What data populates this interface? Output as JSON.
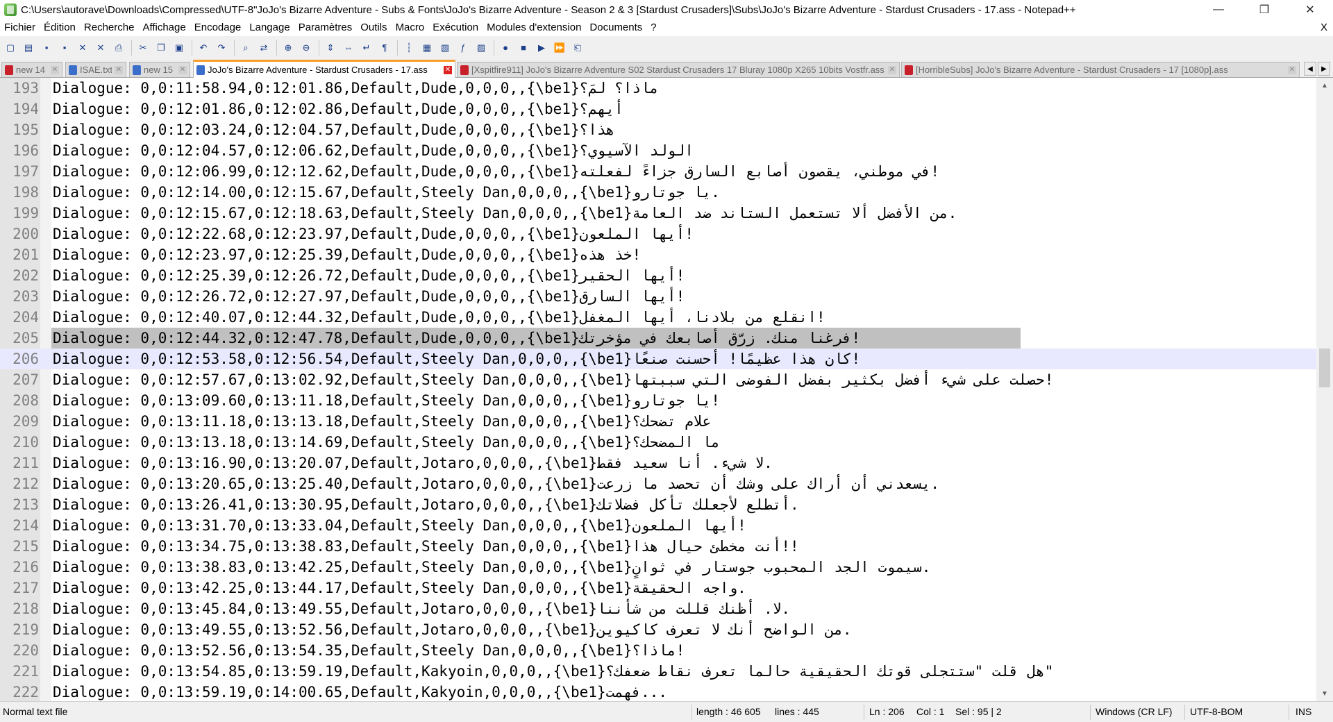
{
  "window": {
    "title": "C:\\Users\\autorave\\Downloads\\Compressed\\UTF-8\"JoJo's Bizarre Adventure - Subs & Fonts\\JoJo's Bizarre Adventure - Season 2 & 3 [Stardust Crusaders]\\Subs\\JoJo's Bizarre Adventure - Stardust Crusaders - 17.ass - Notepad++",
    "minimize": "—",
    "maximize": "❐",
    "close": "✕"
  },
  "menu": {
    "items": [
      "Fichier",
      "Édition",
      "Recherche",
      "Affichage",
      "Encodage",
      "Langage",
      "Paramètres",
      "Outils",
      "Macro",
      "Exécution",
      "Modules d'extension",
      "Documents",
      "?"
    ],
    "close": "X"
  },
  "toolbar": {
    "buttons": [
      "new-file-icon",
      "open-file-icon",
      "save-icon",
      "save-all-icon",
      "close-icon",
      "close-all-icon",
      "print-icon",
      "cut-icon",
      "copy-icon",
      "paste-icon",
      "undo-icon",
      "redo-icon",
      "find-icon",
      "replace-icon",
      "zoom-in-icon",
      "zoom-out-icon",
      "sync-vertical-icon",
      "sync-horizontal-icon",
      "word-wrap-icon",
      "show-all-chars-icon",
      "indent-guide-icon",
      "language-icon",
      "doc-map-icon",
      "function-list-icon",
      "folder-workspace-icon",
      "record-macro-icon",
      "stop-macro-icon",
      "play-macro-icon",
      "run-macro-multiple-icon",
      "save-macro-icon"
    ],
    "glyphs": [
      "▢",
      "▤",
      "▪",
      "▪",
      "✕",
      "✕",
      "⎙",
      "✂",
      "❐",
      "▣",
      "↶",
      "↷",
      "⌕",
      "⇄",
      "⊕",
      "⊖",
      "⇕",
      "⇔",
      "↵",
      "¶",
      "┆",
      "▦",
      "▧",
      "ƒ",
      "▨",
      "●",
      "■",
      "▶",
      "⏩",
      "⎗"
    ]
  },
  "tabs": [
    {
      "label": "new 14",
      "icon": "red",
      "active": false
    },
    {
      "label": "ISAE.txt",
      "icon": "blue",
      "active": false
    },
    {
      "label": "new 15",
      "icon": "blue",
      "active": false
    },
    {
      "label": "JoJo's Bizarre Adventure - Stardust Crusaders - 17.ass",
      "icon": "blue",
      "active": true
    },
    {
      "label": "[Xspitfire911] JoJo's Bizarre Adventure S02 Stardust Crusaders 17 Bluray 1080p X265 10bits Vostfr.ass",
      "icon": "red",
      "active": false
    },
    {
      "label": "[HorribleSubs] JoJo's Bizarre Adventure - Stardust Crusaders - 17 [1080p].ass",
      "icon": "red",
      "active": false
    }
  ],
  "tab_scroll": {
    "left": "◀",
    "right": "▶"
  },
  "editor": {
    "highlighted_line": "206",
    "selected_line": "205",
    "lines": [
      {
        "n": "193",
        "text": "Dialogue: 0,0:11:58.94,0:12:01.86,Default,Dude,0,0,0,,{\\be1}ماذا؟ لمَ؟"
      },
      {
        "n": "194",
        "text": "Dialogue: 0,0:12:01.86,0:12:02.86,Default,Dude,0,0,0,,{\\be1}أيهم؟"
      },
      {
        "n": "195",
        "text": "Dialogue: 0,0:12:03.24,0:12:04.57,Default,Dude,0,0,0,,{\\be1}هذا؟"
      },
      {
        "n": "196",
        "text": "Dialogue: 0,0:12:04.57,0:12:06.62,Default,Dude,0,0,0,,{\\be1}الولد الآسيوي؟"
      },
      {
        "n": "197",
        "text": "Dialogue: 0,0:12:06.99,0:12:12.62,Default,Dude,0,0,0,,{\\be1}في موطني، يقصون أصابع السارق جزاءً لفعلته!"
      },
      {
        "n": "198",
        "text": "Dialogue: 0,0:12:14.00,0:12:15.67,Default,Steely Dan,0,0,0,,{\\be1}يا جوتارو."
      },
      {
        "n": "199",
        "text": "Dialogue: 0,0:12:15.67,0:12:18.63,Default,Steely Dan,0,0,0,,{\\be1}من الأفضل ألا تستعمل الستاند ضد العامة."
      },
      {
        "n": "200",
        "text": "Dialogue: 0,0:12:22.68,0:12:23.97,Default,Dude,0,0,0,,{\\be1}أيها الملعون!"
      },
      {
        "n": "201",
        "text": "Dialogue: 0,0:12:23.97,0:12:25.39,Default,Dude,0,0,0,,{\\be1}خذ هذه!"
      },
      {
        "n": "202",
        "text": "Dialogue: 0,0:12:25.39,0:12:26.72,Default,Dude,0,0,0,,{\\be1}أيها الحقير!"
      },
      {
        "n": "203",
        "text": "Dialogue: 0,0:12:26.72,0:12:27.97,Default,Dude,0,0,0,,{\\be1}أيها السارق!"
      },
      {
        "n": "204",
        "text": "Dialogue: 0,0:12:40.07,0:12:44.32,Default,Dude,0,0,0,,{\\be1}انقلع من بلادنا، أيها المغفل!"
      },
      {
        "n": "205",
        "text": "Dialogue: 0,0:12:44.32,0:12:47.78,Default,Dude,0,0,0,,{\\be1}فرغنا منك. زرّق أصابعك في مؤخرتك!"
      },
      {
        "n": "206",
        "text": "Dialogue: 0,0:12:53.58,0:12:56.54,Default,Steely Dan,0,0,0,,{\\be1}كان هذا عظيمًا! أحسنت صنعًا!"
      },
      {
        "n": "207",
        "text": "Dialogue: 0,0:12:57.67,0:13:02.92,Default,Steely Dan,0,0,0,,{\\be1}حصلت على شيء أفضل بكثير بفضل الفوضى التي سببتها!"
      },
      {
        "n": "208",
        "text": "Dialogue: 0,0:13:09.60,0:13:11.18,Default,Steely Dan,0,0,0,,{\\be1}يا جوتارو!"
      },
      {
        "n": "209",
        "text": "Dialogue: 0,0:13:11.18,0:13:13.18,Default,Steely Dan,0,0,0,,{\\be1}علام تضحك؟"
      },
      {
        "n": "210",
        "text": "Dialogue: 0,0:13:13.18,0:13:14.69,Default,Steely Dan,0,0,0,,{\\be1}ما المضحك؟"
      },
      {
        "n": "211",
        "text": "Dialogue: 0,0:13:16.90,0:13:20.07,Default,Jotaro,0,0,0,,{\\be1}لا شيء. أنا سعيد فقط."
      },
      {
        "n": "212",
        "text": "Dialogue: 0,0:13:20.65,0:13:25.40,Default,Jotaro,0,0,0,,{\\be1}يسعدني أن أراك على وشك أن تحصد ما زرعت."
      },
      {
        "n": "213",
        "text": "Dialogue: 0,0:13:26.41,0:13:30.95,Default,Jotaro,0,0,0,,{\\be1}أتطلع لأجعلك تأكل فضلاتك."
      },
      {
        "n": "214",
        "text": "Dialogue: 0,0:13:31.70,0:13:33.04,Default,Steely Dan,0,0,0,,{\\be1}أيها الملعون!"
      },
      {
        "n": "215",
        "text": "Dialogue: 0,0:13:34.75,0:13:38.83,Default,Steely Dan,0,0,0,,{\\be1}أنت مخطئ حيال هذا!!"
      },
      {
        "n": "216",
        "text": "Dialogue: 0,0:13:38.83,0:13:42.25,Default,Steely Dan,0,0,0,,{\\be1}سيموت الجد المحبوب جوستار في ثوانٍ."
      },
      {
        "n": "217",
        "text": "Dialogue: 0,0:13:42.25,0:13:44.17,Default,Steely Dan,0,0,0,,{\\be1}واجه الحقيقة."
      },
      {
        "n": "218",
        "text": "Dialogue: 0,0:13:45.84,0:13:49.55,Default,Jotaro,0,0,0,,{\\be1}لا. أظنك قللت من شأننا."
      },
      {
        "n": "219",
        "text": "Dialogue: 0,0:13:49.55,0:13:52.56,Default,Jotaro,0,0,0,,{\\be1}من الواضح أنك لا تعرف كاكيوين."
      },
      {
        "n": "220",
        "text": "Dialogue: 0,0:13:52.56,0:13:54.35,Default,Steely Dan,0,0,0,,{\\be1}ماذا؟!"
      },
      {
        "n": "221",
        "text": "Dialogue: 0,0:13:54.85,0:13:59.19,Default,Kakyoin,0,0,0,,{\\be1}هل قلت \"ستتجلى قوتك الحقيقية حالما تعرف نقاط ضعفك؟\""
      },
      {
        "n": "222",
        "text": "Dialogue: 0,0:13:59.19,0:14:00.65,Default,Kakyoin,0,0,0,,{\\be1}فهمت..."
      }
    ]
  },
  "scrollbar": {
    "up": "▲",
    "down": "▼"
  },
  "status": {
    "file_type": "Normal text file",
    "length": "length : 46 605",
    "lines": "lines : 445",
    "ln": "Ln : 206",
    "col": "Col : 1",
    "sel": "Sel : 95 | 2",
    "eol": "Windows (CR LF)",
    "encoding": "UTF-8-BOM",
    "mode": "INS"
  }
}
